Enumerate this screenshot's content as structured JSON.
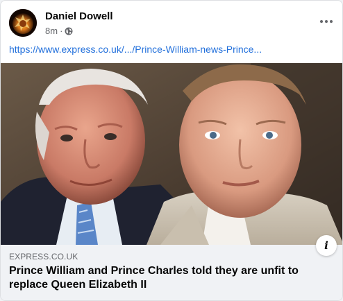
{
  "post": {
    "author": "Daniel Dowell",
    "time": "8m",
    "separator": "·",
    "privacy_icon": "globe-icon",
    "more_icon": "more-horizontal-icon",
    "link_text": "https://www.express.co.uk/.../Prince-William-news-Prince..."
  },
  "link_preview": {
    "domain": "EXPRESS.CO.UK",
    "headline": "Prince William and Prince Charles told they are unfit to replace Queen Elizabeth II",
    "info_icon": "info-icon",
    "info_glyph": "i"
  },
  "colors": {
    "link": "#216fdb",
    "secondary_text": "#65676b",
    "primary_text": "#050505",
    "footer_bg": "#f0f2f5"
  }
}
